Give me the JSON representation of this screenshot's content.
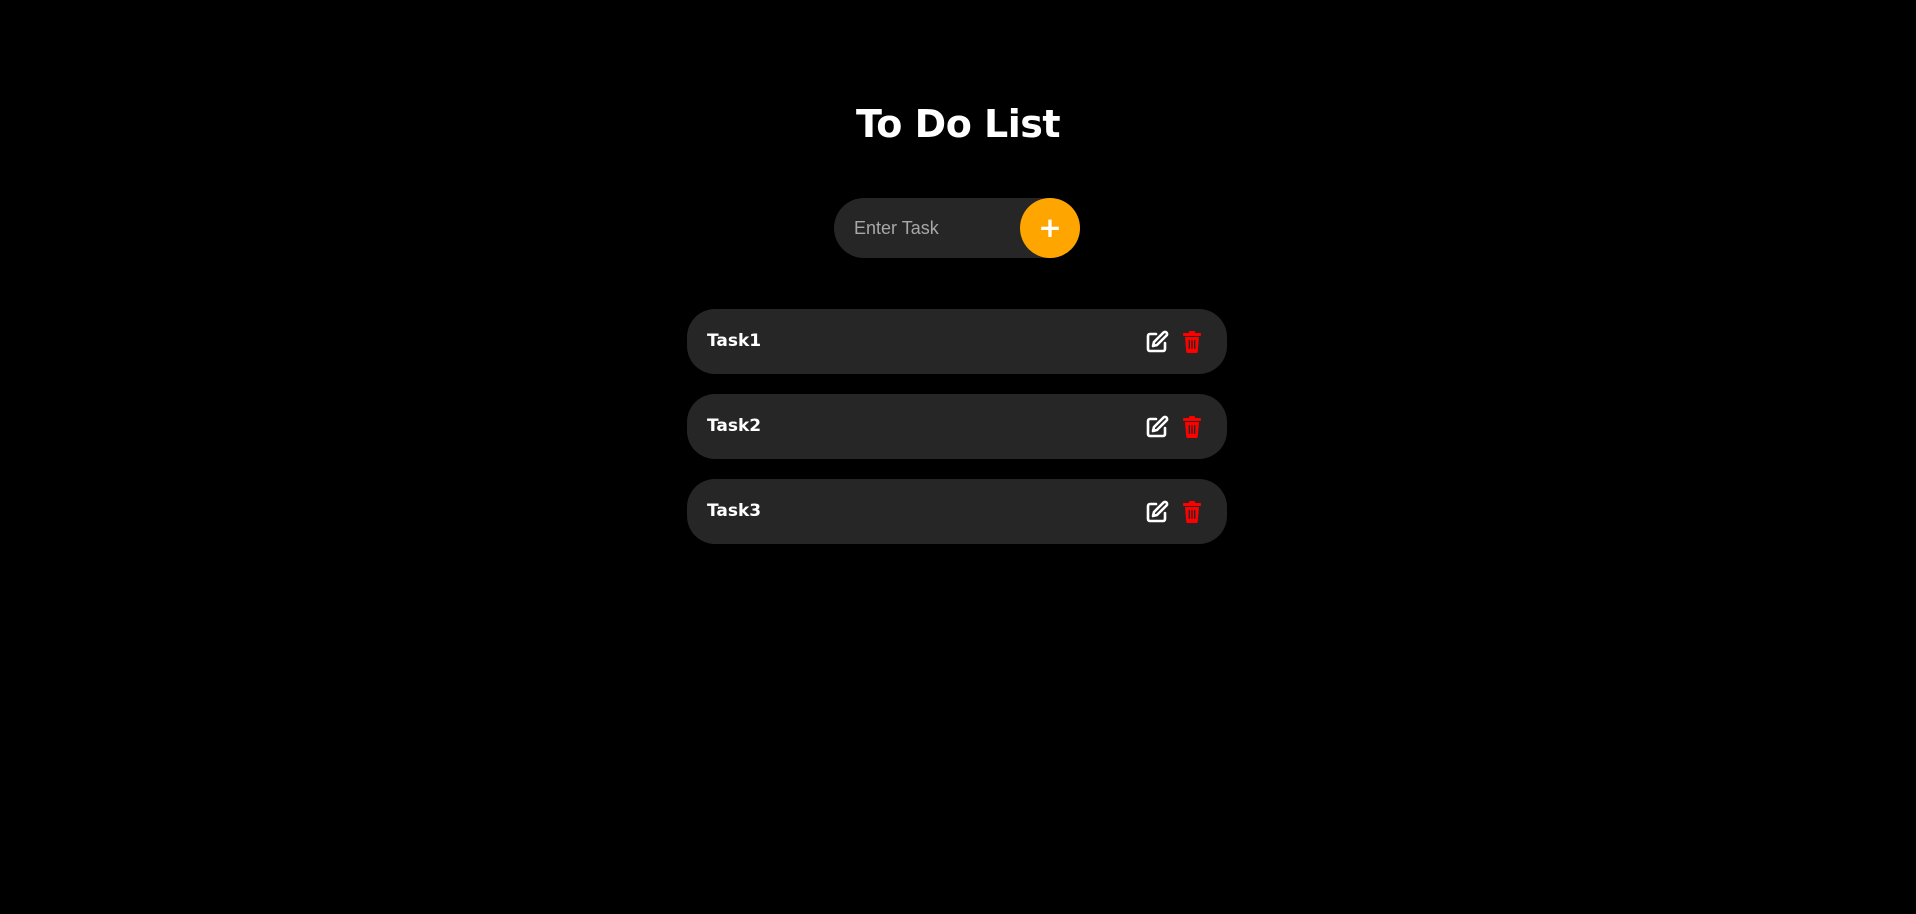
{
  "app": {
    "title": "To Do List"
  },
  "add_form": {
    "placeholder": "Enter Task",
    "value": "",
    "add_label": "+"
  },
  "tasks": [
    {
      "label": "Task1"
    },
    {
      "label": "Task2"
    },
    {
      "label": "Task3"
    }
  ],
  "icons": {
    "add": "plus-icon",
    "edit": "edit-icon",
    "delete": "trash-icon"
  },
  "colors": {
    "background": "#000000",
    "surface": "#262626",
    "accent": "#ffa500",
    "delete": "#ff0000",
    "text": "#ffffff",
    "placeholder": "#a8a8a8"
  }
}
